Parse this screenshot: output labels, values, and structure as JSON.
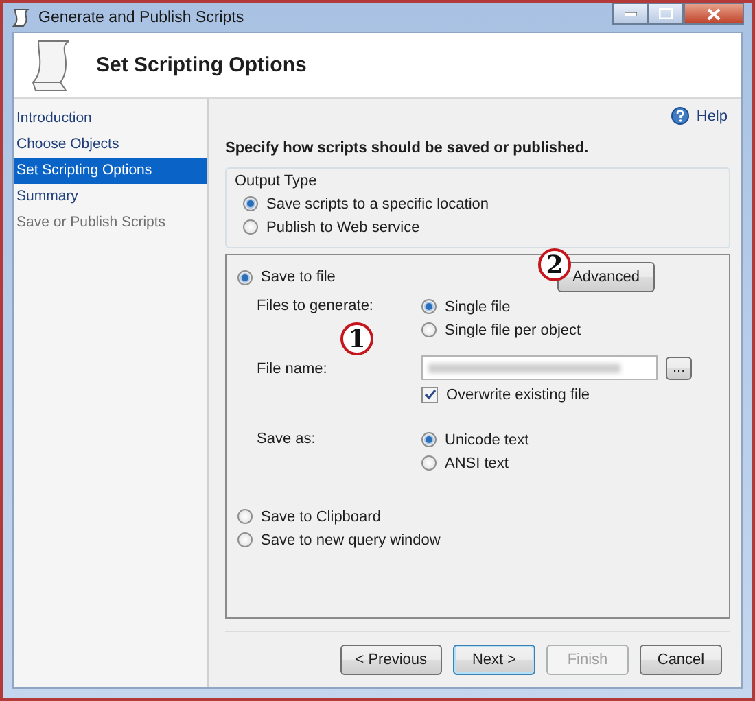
{
  "window": {
    "title": "Generate and Publish Scripts"
  },
  "header": {
    "title": "Set Scripting Options"
  },
  "sidebar": {
    "items": [
      {
        "label": "Introduction",
        "selected": false,
        "disabled": false
      },
      {
        "label": "Choose Objects",
        "selected": false,
        "disabled": false
      },
      {
        "label": "Set Scripting Options",
        "selected": true,
        "disabled": false
      },
      {
        "label": "Summary",
        "selected": false,
        "disabled": false
      },
      {
        "label": "Save or Publish Scripts",
        "selected": false,
        "disabled": true
      }
    ]
  },
  "help": {
    "label": "Help"
  },
  "instruction": "Specify how scripts should be saved or published.",
  "output_type": {
    "label": "Output Type",
    "options": [
      {
        "label": "Save scripts to a specific location",
        "selected": true
      },
      {
        "label": "Publish to Web service",
        "selected": false
      }
    ]
  },
  "save_options": {
    "modes": [
      {
        "label": "Save to file",
        "selected": true
      },
      {
        "label": "Save to Clipboard",
        "selected": false
      },
      {
        "label": "Save to new query window",
        "selected": false
      }
    ],
    "advanced_button": "Advanced",
    "files_to_generate": {
      "label": "Files to generate:",
      "options": [
        {
          "label": "Single file",
          "selected": true
        },
        {
          "label": "Single file per object",
          "selected": false
        }
      ]
    },
    "file_name": {
      "label": "File name:",
      "browse_button": "..."
    },
    "overwrite": {
      "label": "Overwrite existing file",
      "checked": true
    },
    "save_as": {
      "label": "Save as:",
      "options": [
        {
          "label": "Unicode text",
          "selected": true
        },
        {
          "label": "ANSI text",
          "selected": false
        }
      ]
    }
  },
  "annotations": [
    {
      "text": "1"
    },
    {
      "text": "2"
    }
  ],
  "buttons": [
    {
      "label": "< Previous",
      "disabled": false,
      "default": false
    },
    {
      "label": "Next >",
      "disabled": false,
      "default": true
    },
    {
      "label": "Finish",
      "disabled": true,
      "default": false
    },
    {
      "label": "Cancel",
      "disabled": false,
      "default": false
    }
  ]
}
